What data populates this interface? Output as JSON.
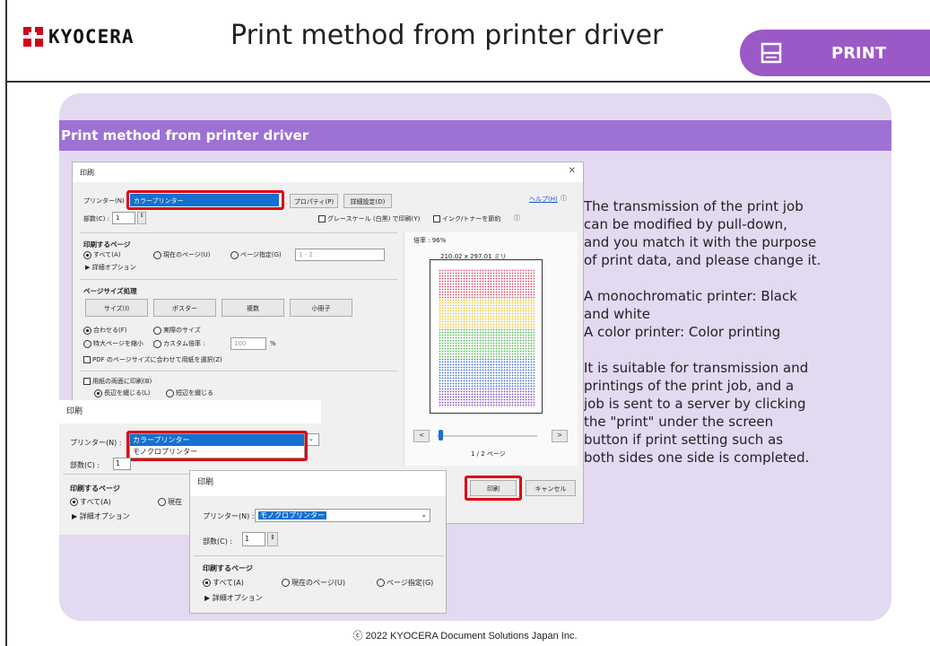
{
  "header": {
    "logo_text": "KYOCERA",
    "title": "Print method from printer driver",
    "badge_label": "PRINT",
    "brand_color": "#d0021b",
    "accent_color": "#9b59c8"
  },
  "panel": {
    "heading": "Print method from printer driver",
    "paragraphs": [
      "The transmission of the print job\ncan be modified by pull-down,\nand you match it with the purpose\nof print data, and please change it.",
      "A monochromatic printer: Black\nand white\nA color printer: Color printing",
      "It is suitable for transmission and\nprintings of the print job, and a\njob is sent to a server by clicking\nthe \"print\" under the screen\nbutton if print setting such as\nboth sides one side is completed."
    ]
  },
  "dialog": {
    "title": "印刷",
    "help_link": "ヘルプ(H)",
    "printer_label": "プリンター(N) :",
    "printer_value": "カラープリンター",
    "properties_btn": "プロパティ(P)",
    "advanced_btn": "詳細設定(D)",
    "copies_label": "部数(C) :",
    "copies_value": "1",
    "grayscale_label": "グレースケール (白黒) で印刷(Y)",
    "ink_saver_label": "インク/トナーを節約",
    "pages_section": "印刷するページ",
    "all_option": "すべて(A)",
    "current_page_option": "現在のページ(U)",
    "page_range_option": "ページ指定(G)",
    "page_range_value": "1 - 2",
    "more_options": "▶ 詳細オプション",
    "size_section": "ページサイズ処理",
    "size_buttons": [
      "サイズ(I)",
      "ポスター",
      "複数",
      "小冊子"
    ],
    "fit_option": "合わせる(F)",
    "actual_size_option": "実際のサイズ",
    "shrink_option": "特大ページを縮小",
    "custom_scale_option": "カスタム倍率 :",
    "custom_scale_value": "100",
    "custom_scale_unit": "%",
    "pdf_paper_option": "PDF のページサイズに合わせて用紙を選択(Z)",
    "duplex_option": "用紙の両面に印刷(B)",
    "long_edge_option": "長辺を綴じる(L)",
    "short_edge_option": "短辺を綴じる",
    "zoom_label": "倍率 : 96%",
    "paper_size": "210.02 x 297.01 ミリ",
    "page_counter": "1 / 2 ページ",
    "prev_page_btn": "<",
    "next_page_btn": ">",
    "print_btn": "印刷",
    "cancel_btn": "キャンセル"
  },
  "dropdown_dialog": {
    "title": "印刷",
    "printer_label": "プリンター(N) :",
    "options": [
      "カラープリンター",
      "モノクロプリンター"
    ],
    "copies_label": "部数(C) :",
    "copies_value": "1",
    "pages_section": "印刷するページ",
    "all_option": "すべて(A)",
    "current_page_option": "現在",
    "more_options": "▶ 詳細オプション"
  },
  "mono_dialog": {
    "title": "印刷",
    "printer_label": "プリンター(N) :",
    "printer_value": "モノクロプリンター",
    "copies_label": "部数(C) :",
    "copies_value": "1",
    "pages_section": "印刷するページ",
    "all_option": "すべて(A)",
    "current_page_option": "現在のページ(U)",
    "page_range_option": "ページ指定(G)",
    "more_options": "▶ 詳細オプション"
  },
  "footer": {
    "copyright": "ⓒ 2022 KYOCERA Document Solutions Japan Inc."
  }
}
